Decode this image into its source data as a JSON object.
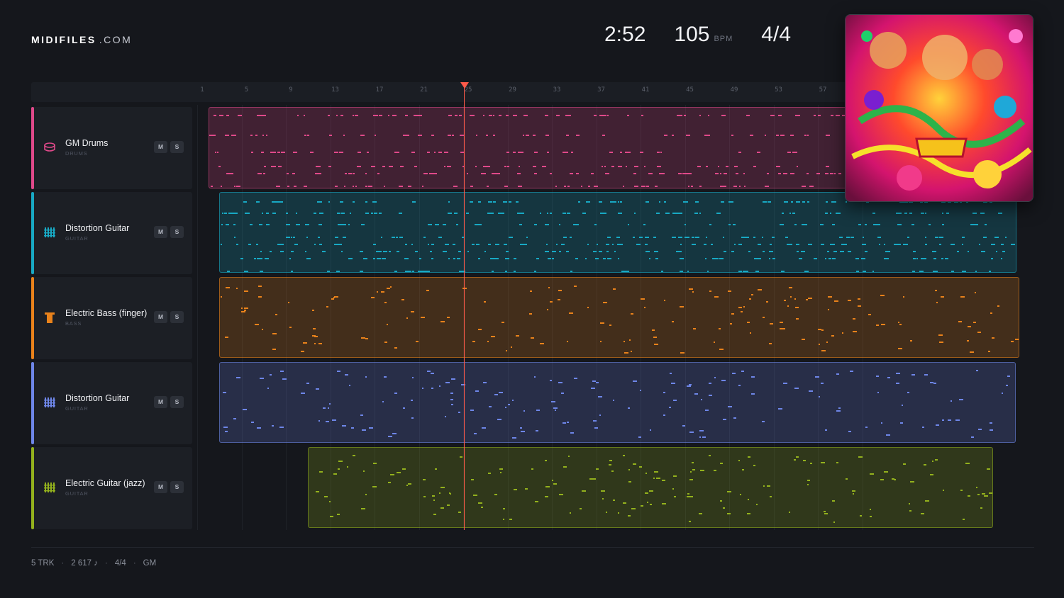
{
  "brand": {
    "name": "MIDIFILES",
    "suffix": ".COM"
  },
  "stats": {
    "time": "2:52",
    "bpm": "105",
    "bpm_unit": "BPM",
    "time_signature": "4/4"
  },
  "ruler": [
    "1",
    "5",
    "9",
    "13",
    "17",
    "21",
    "25",
    "29",
    "33",
    "37",
    "41",
    "45",
    "49",
    "53",
    "57"
  ],
  "tracks": [
    {
      "name": "GM Drums",
      "category": "DRUMS",
      "color": "#e0498a",
      "icon": "drum-icon",
      "mute": "M",
      "solo": "S"
    },
    {
      "name": "Distortion Guitar",
      "category": "GUITAR",
      "color": "#18a9c4",
      "icon": "guitar-icon",
      "mute": "M",
      "solo": "S"
    },
    {
      "name": "Electric Bass (finger)",
      "category": "BASS",
      "color": "#e9821b",
      "icon": "bass-icon",
      "mute": "M",
      "solo": "S"
    },
    {
      "name": "Distortion Guitar",
      "category": "GUITAR",
      "color": "#6e86e8",
      "icon": "guitar-icon",
      "mute": "M",
      "solo": "S"
    },
    {
      "name": "Electric Guitar (jazz)",
      "category": "GUITAR",
      "color": "#93b11d",
      "icon": "guitar-icon",
      "mute": "M",
      "solo": "S"
    }
  ],
  "album_cover": {
    "icon": "album-cover-art"
  },
  "footer": {
    "tracks": "5 TRK",
    "notes": "2 617 ♪",
    "signature": "4/4",
    "standard": "GM"
  }
}
